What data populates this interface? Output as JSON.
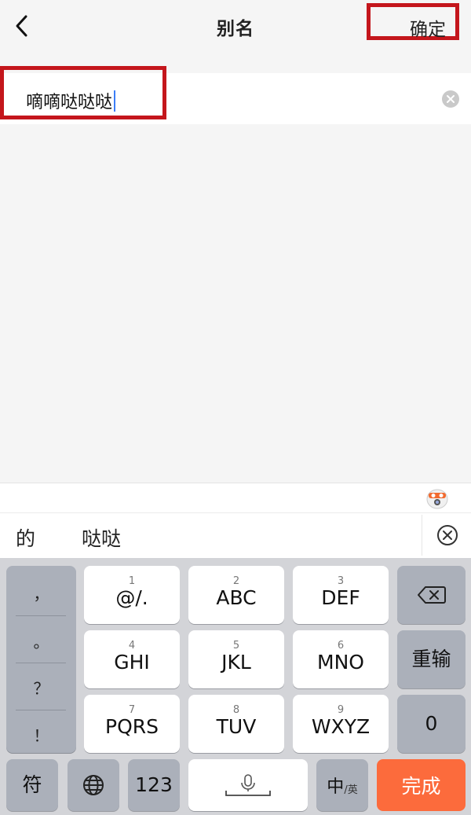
{
  "header": {
    "title": "别名",
    "confirm_label": "确定"
  },
  "input": {
    "value": "嘀嘀哒哒哒"
  },
  "candidates": [
    "的",
    "哒哒"
  ],
  "keyboard": {
    "punct": [
      "，",
      "。",
      "？",
      "！"
    ],
    "keys": [
      {
        "num": "1",
        "label": "@/."
      },
      {
        "num": "2",
        "label": "ABC"
      },
      {
        "num": "3",
        "label": "DEF"
      },
      {
        "num": "4",
        "label": "GHI"
      },
      {
        "num": "5",
        "label": "JKL"
      },
      {
        "num": "6",
        "label": "MNO"
      },
      {
        "num": "7",
        "label": "PQRS"
      },
      {
        "num": "8",
        "label": "TUV"
      },
      {
        "num": "9",
        "label": "WXYZ"
      }
    ],
    "retype_label": "重输",
    "zero_label": "0",
    "symbol_label": "符",
    "num_label": "123",
    "lang_main": "中",
    "lang_sub": "/英",
    "done_label": "完成"
  },
  "colors": {
    "accent": "#fc6b3c",
    "highlight": "#c4161c",
    "caret": "#3b7ef8"
  }
}
